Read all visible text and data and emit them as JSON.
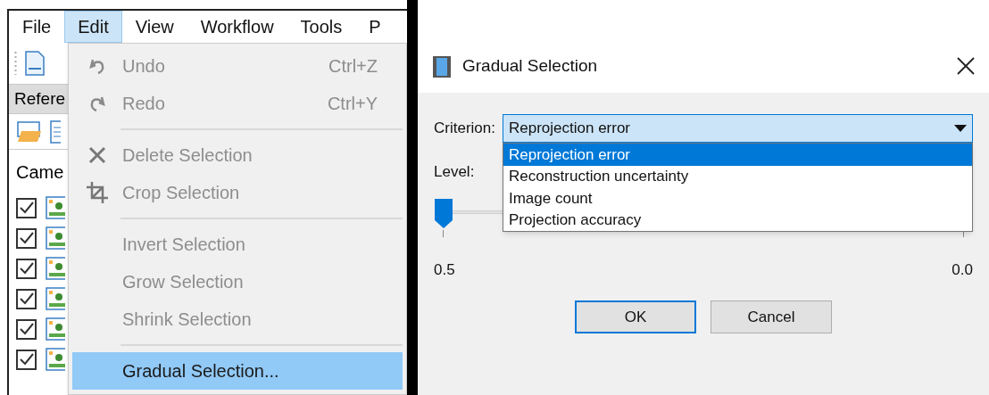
{
  "main_window": {
    "menu_bar": [
      {
        "label": "File",
        "selected": false
      },
      {
        "label": "Edit",
        "selected": true
      },
      {
        "label": "View",
        "selected": false
      },
      {
        "label": "Workflow",
        "selected": false
      },
      {
        "label": "Tools",
        "selected": false
      },
      {
        "label": "P",
        "selected": false
      }
    ],
    "panel_tab": "Refere",
    "panel_heading": "Came",
    "camera_rows": [
      {
        "checked": true
      },
      {
        "checked": true
      },
      {
        "checked": true
      },
      {
        "checked": true
      },
      {
        "checked": true
      },
      {
        "checked": true
      }
    ]
  },
  "edit_menu": {
    "items": [
      {
        "kind": "item",
        "label": "Undo",
        "shortcut": "Ctrl+Z",
        "disabled": true,
        "selected": false
      },
      {
        "kind": "item",
        "label": "Redo",
        "shortcut": "Ctrl+Y",
        "disabled": true,
        "selected": false
      },
      {
        "kind": "separator"
      },
      {
        "kind": "item",
        "label": "Delete Selection",
        "disabled": true,
        "selected": false
      },
      {
        "kind": "item",
        "label": "Crop Selection",
        "disabled": true,
        "selected": false
      },
      {
        "kind": "separator"
      },
      {
        "kind": "item",
        "label": "Invert Selection",
        "disabled": true,
        "selected": false
      },
      {
        "kind": "item",
        "label": "Grow Selection",
        "disabled": true,
        "selected": false
      },
      {
        "kind": "item",
        "label": "Shrink Selection",
        "disabled": true,
        "selected": false
      },
      {
        "kind": "separator"
      },
      {
        "kind": "item",
        "label": "Gradual Selection...",
        "disabled": false,
        "selected": true
      }
    ]
  },
  "dialog": {
    "title": "Gradual Selection",
    "criterion_label": "Criterion:",
    "criterion_value": "Reprojection error",
    "criterion_options": [
      {
        "label": "Reprojection error",
        "selected": true
      },
      {
        "label": "Reconstruction uncertainty",
        "selected": false
      },
      {
        "label": "Image count",
        "selected": false
      },
      {
        "label": "Projection accuracy",
        "selected": false
      }
    ],
    "level_label": "Level:",
    "slider": {
      "level": 0
    },
    "min_label": "0.5",
    "max_label": "0.0",
    "buttons": [
      {
        "label": "OK",
        "default": true
      },
      {
        "label": "Cancel",
        "default": false
      }
    ]
  }
}
